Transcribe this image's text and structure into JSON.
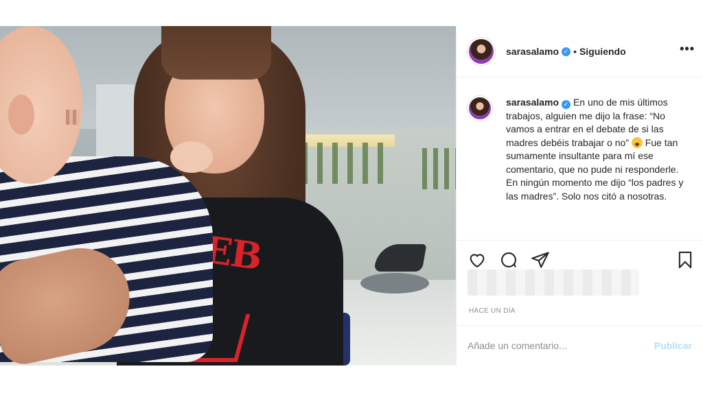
{
  "post": {
    "username": "sarasalamo",
    "follow_status": "Siguiendo",
    "separator": "•",
    "verified_icon": "verified-badge-icon",
    "caption_text": "En uno de mis últimos trabajos, alguien me dijo la frase: “No vamos a entrar en el debate de si las madres debéis trabajar o no”",
    "caption_text_2": "Fue tan sumamente insultante para mí ese comentario, que no pude ni responderle.",
    "caption_text_3": "En ningún momento me dijo “los padres y las madres”. Solo nos citó a nosotras.",
    "time_ago": "HACE UN DÍA",
    "comment_placeholder": "Añade un comentario...",
    "publish_label": "Publicar",
    "more_label": "•••",
    "photo_print_text": "QREB"
  },
  "icons": {
    "like": "heart-icon",
    "comment": "comment-bubble-icon",
    "share": "paper-plane-icon",
    "save": "bookmark-icon",
    "emoji": "astonished-face-emoji"
  },
  "colors": {
    "accent": "#3897f0",
    "publish_disabled": "#b2dffc",
    "muted_text": "#8e8e8e",
    "border": "#efefef"
  }
}
